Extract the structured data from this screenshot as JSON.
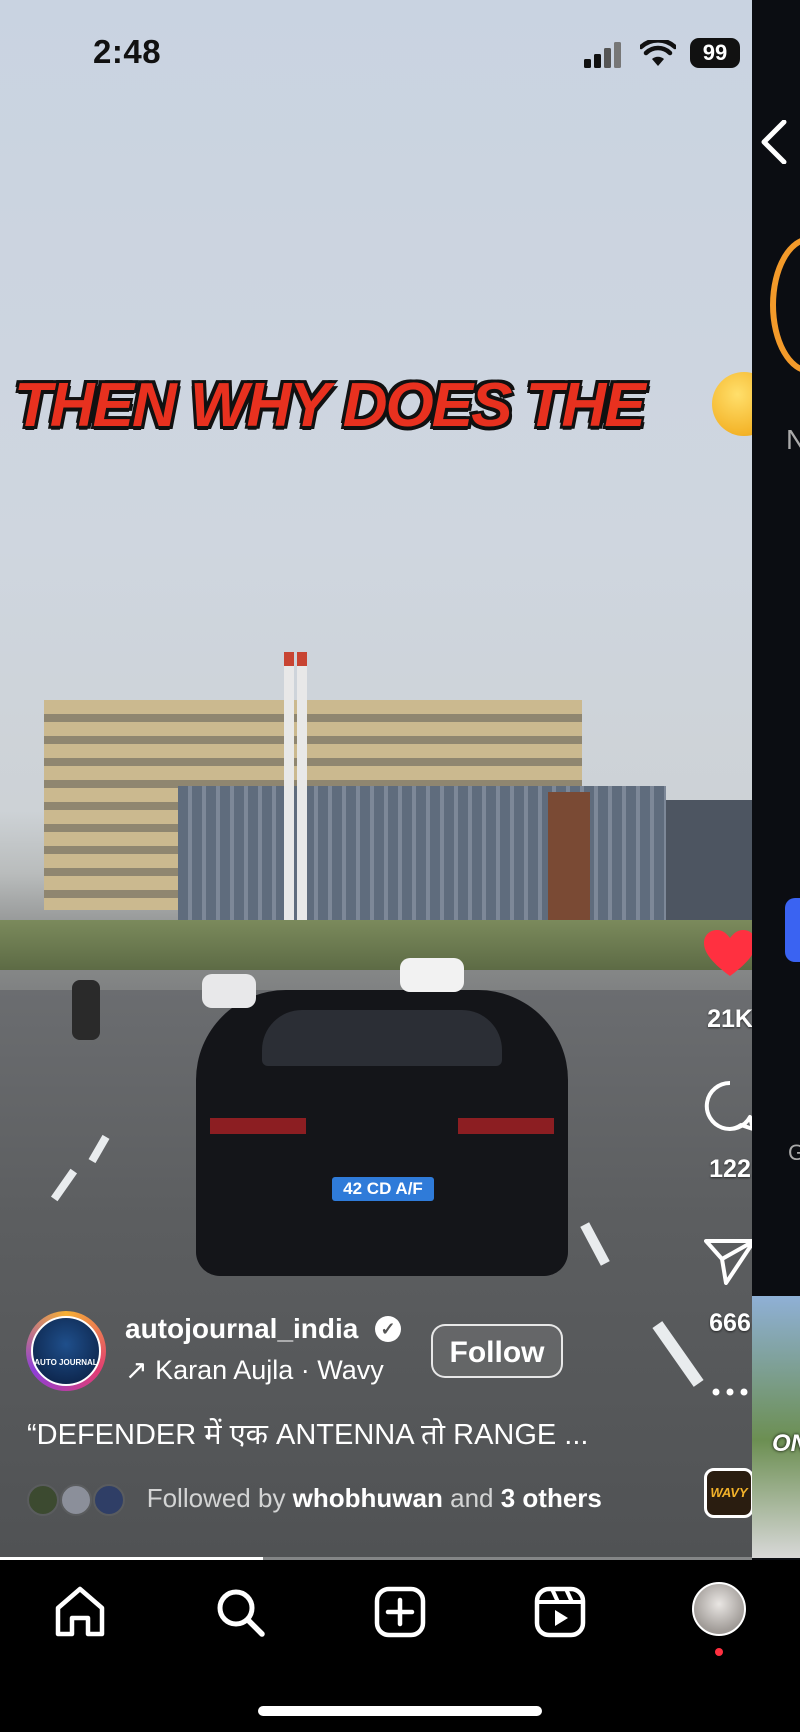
{
  "status_bar": {
    "time": "2:48",
    "battery": "99"
  },
  "overlay_caption": "THEN WHY DOES THE",
  "scene": {
    "license_plate": "42 CD A/F"
  },
  "actions": {
    "likes": "21K",
    "comments": "122",
    "shares": "666"
  },
  "post": {
    "username": "autojournal_india",
    "avatar_text": "AUTO JOURNAL",
    "music": "Karan Aujla · Wavy",
    "follow_label": "Follow",
    "description": "“DEFENDER में एक ANTENNA तो RANGE ...",
    "followed_prefix": "Followed by",
    "followed_user": "whobhuwan",
    "followed_and": "and",
    "followed_others": "3 others"
  },
  "audio_thumb_text": "WAVY",
  "right_panel": {
    "partial_letter_1": "N",
    "partial_letter_2": "G",
    "thumb_text": "ON"
  },
  "progress": 0.35,
  "colors": {
    "like": "#ff3040",
    "notification_dot": "#ff3040",
    "accent_blue": "#3a63f2"
  }
}
